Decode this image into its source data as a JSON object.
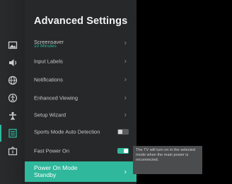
{
  "panel": {
    "title": "Advanced Settings"
  },
  "menu": {
    "screensaver": {
      "label": "Screensaver",
      "value": "10 Minutes"
    },
    "input_labels": {
      "label": "Input Labels"
    },
    "notifications": {
      "label": "Notifications"
    },
    "enhanced_viewing": {
      "label": "Enhanced Viewing"
    },
    "setup_wizard": {
      "label": "Setup Wizard"
    },
    "sports_mode": {
      "label": "Sports Mode Auto Detection",
      "state": "off"
    },
    "fast_power_on": {
      "label": "Fast Power On",
      "state": "on"
    },
    "power_on_mode": {
      "label": "Power On Mode",
      "value": "Standby"
    }
  },
  "tooltip": {
    "text": "The TV will turn on in the selected mode when the main power is reconnected."
  },
  "colors": {
    "accent": "#2fb89b",
    "panel_bg": "#27282a",
    "background": "#000000"
  },
  "rail_icons": [
    "picture-icon",
    "sound-icon",
    "network-icon",
    "accessibility-icon",
    "system-icon",
    "advanced-settings-icon",
    "support-icon"
  ]
}
